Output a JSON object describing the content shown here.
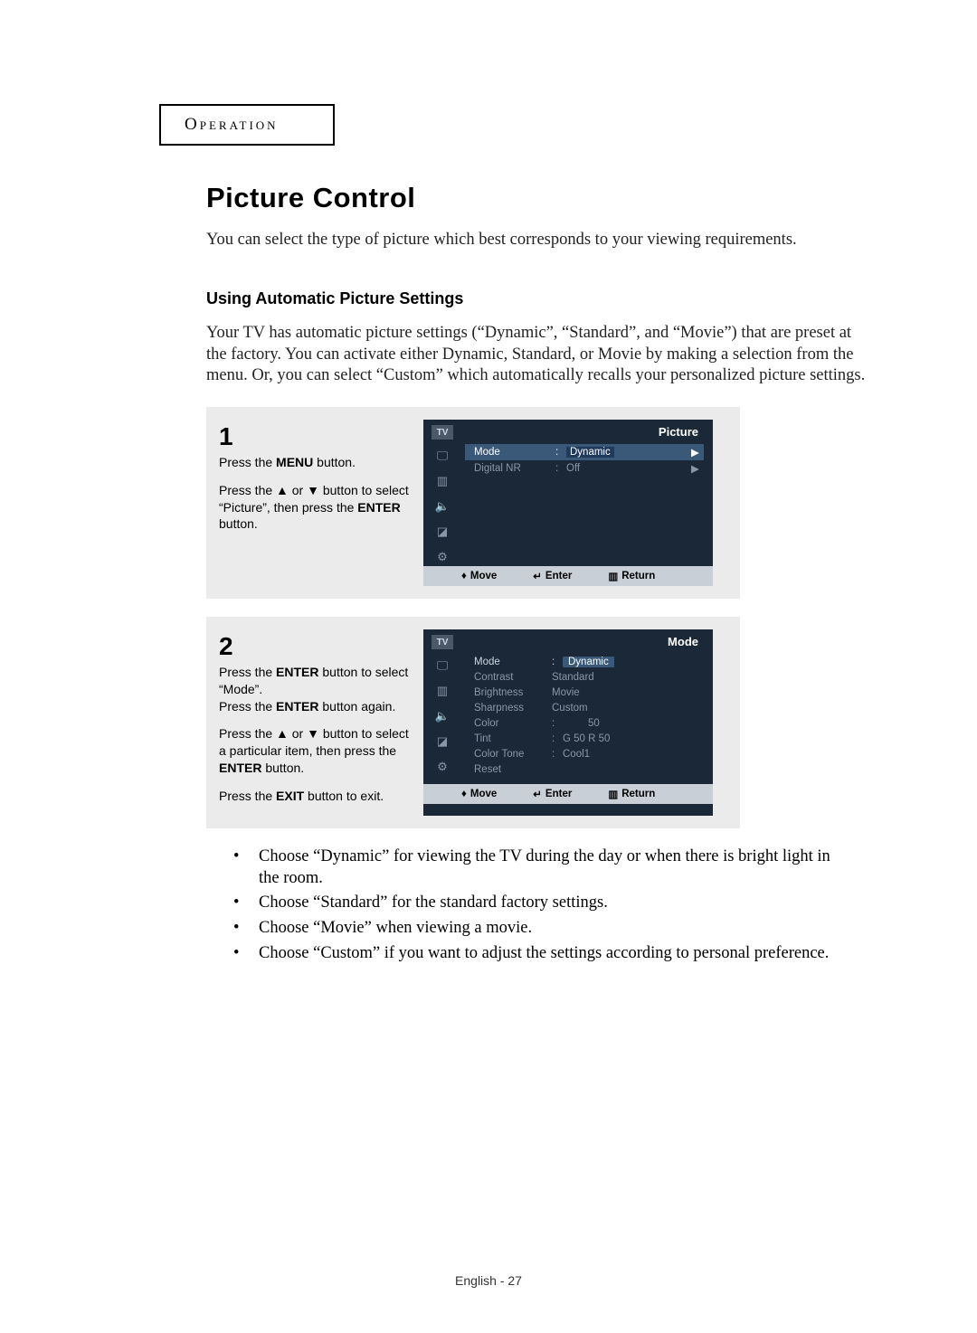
{
  "header": {
    "section": "Operation"
  },
  "title": "Picture Control",
  "intro": "You can select the type of picture which best corresponds to your viewing requirements.",
  "subhead": "Using Automatic Picture Settings",
  "body": "Your TV has automatic picture settings (“Dynamic”, “Standard”, and “Movie”) that are preset at the factory. You can activate either Dynamic, Standard, or Movie by making a selection from the menu. Or, you can select “Custom” which automatically recalls your personalized picture settings.",
  "steps": [
    {
      "num": "1",
      "lines": [
        "Press the <b>MENU</b> button.",
        "Press the ▲ or ▼ button to select “Picture”, then press the <b>ENTER</b> button."
      ],
      "osd": {
        "title": "Picture",
        "rows": [
          {
            "label": "Mode",
            "val": "Dynamic",
            "hl": true,
            "arrow": "▶"
          },
          {
            "label": "Digital NR",
            "val": "Off",
            "hl": false,
            "arrow": "▶"
          }
        ],
        "bar": {
          "move": "Move",
          "enter": "Enter",
          "return": "Return"
        }
      }
    },
    {
      "num": "2",
      "lines": [
        "Press the <b>ENTER</b> button to select “Mode”.",
        "Press the <b>ENTER</b> button again.",
        "Press the ▲ or ▼ button to select a particular item, then press the <b>ENTER</b> button.",
        "Press the <b>EXIT</b> button to exit."
      ],
      "osd": {
        "title": "Mode",
        "rows": [
          {
            "label": "Mode",
            "colon": ":",
            "val": "Dynamic",
            "boxed": true
          },
          {
            "label": "Contrast",
            "val": "Standard"
          },
          {
            "label": "Brightness",
            "val": "Movie"
          },
          {
            "label": "Sharpness",
            "val": "Custom"
          },
          {
            "label": "Color",
            "colon": ":",
            "val": "50",
            "indent": true
          },
          {
            "label": "Tint",
            "colon": ":",
            "val": "G 50    R 50"
          },
          {
            "label": "Color Tone",
            "colon": ":",
            "val": "Cool1"
          },
          {
            "label": "Reset",
            "val": ""
          }
        ],
        "bar": {
          "move": "Move",
          "enter": "Enter",
          "return": "Return"
        }
      }
    }
  ],
  "bullets": [
    "Choose “Dynamic” for viewing the TV during the day or when there is bright light in the room.",
    "Choose “Standard” for the standard factory settings.",
    "Choose “Movie” when viewing a movie.",
    "Choose “Custom” if you want to adjust the settings according to personal preference."
  ],
  "page_num": "English - 27",
  "icons": {
    "tv": "TV",
    "up_down": "▲▼",
    "enter_glyph": "↵",
    "menu_glyph": "☰"
  }
}
